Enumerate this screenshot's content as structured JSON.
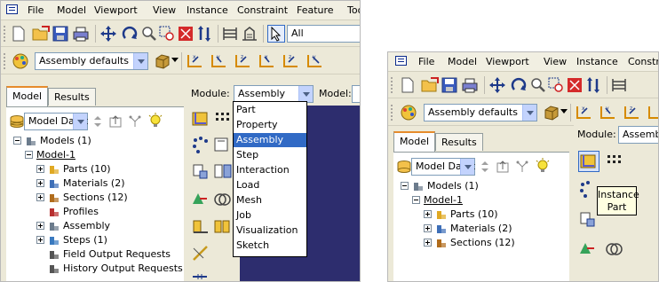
{
  "menu": [
    "File",
    "Model",
    "Viewport",
    "View",
    "Instance",
    "Constraint",
    "Feature",
    "Tools"
  ],
  "menu_underline": [
    "F",
    "M",
    "p",
    "V",
    "I",
    "o",
    "u",
    "T"
  ],
  "menu_right": [
    "File",
    "Model",
    "Viewport",
    "View",
    "Instance",
    "Constraint"
  ],
  "toolbar_right_text": "All",
  "assembly_combo": "Assembly defaults",
  "tabs": {
    "model": "Model",
    "results": "Results"
  },
  "model_db_combo": "Model Datat",
  "module_label": "Module:",
  "module_value": "Assembly",
  "model_label": "Model:",
  "module_options": [
    "Part",
    "Property",
    "Assembly",
    "Step",
    "Interaction",
    "Load",
    "Mesh",
    "Job",
    "Visualization",
    "Sketch"
  ],
  "module_selected_index": 2,
  "tree_left": [
    {
      "label": "Models (1)",
      "indent": 0,
      "expander": "minus",
      "icon": "models-icon"
    },
    {
      "label": "Model-1",
      "indent": 1,
      "expander": "minus",
      "icon": "",
      "underline": true
    },
    {
      "label": "Parts (10)",
      "indent": 2,
      "expander": "plus",
      "icon": "parts-icon"
    },
    {
      "label": "Materials (2)",
      "indent": 2,
      "expander": "plus",
      "icon": "materials-icon"
    },
    {
      "label": "Sections (12)",
      "indent": 2,
      "expander": "plus",
      "icon": "sections-icon"
    },
    {
      "label": "Profiles",
      "indent": 2,
      "expander": "",
      "icon": "profiles-icon"
    },
    {
      "label": "Assembly",
      "indent": 2,
      "expander": "plus",
      "icon": "assembly-icon"
    },
    {
      "label": "Steps (1)",
      "indent": 2,
      "expander": "plus",
      "icon": "steps-icon"
    },
    {
      "label": "Field Output Requests",
      "indent": 2,
      "expander": "",
      "icon": "field-output-icon"
    },
    {
      "label": "History Output Requests",
      "indent": 2,
      "expander": "",
      "icon": "history-output-icon"
    }
  ],
  "tree_right": [
    {
      "label": "Models (1)",
      "indent": 0,
      "expander": "minus",
      "icon": "models-icon"
    },
    {
      "label": "Model-1",
      "indent": 1,
      "expander": "minus",
      "icon": "",
      "underline": true
    },
    {
      "label": "Parts (10)",
      "indent": 2,
      "expander": "plus",
      "icon": "parts-icon"
    },
    {
      "label": "Materials (2)",
      "indent": 2,
      "expander": "plus",
      "icon": "materials-icon"
    },
    {
      "label": "Sections (12)",
      "indent": 2,
      "expander": "plus",
      "icon": "sections-icon"
    }
  ],
  "tooltip": {
    "line1": "Instance",
    "line2": "Part"
  },
  "module_value_right": "Assemb",
  "colors": {
    "selection": "#316ac5",
    "viewport": "#2d2d6e",
    "tab_accent": "#e68b2c"
  }
}
